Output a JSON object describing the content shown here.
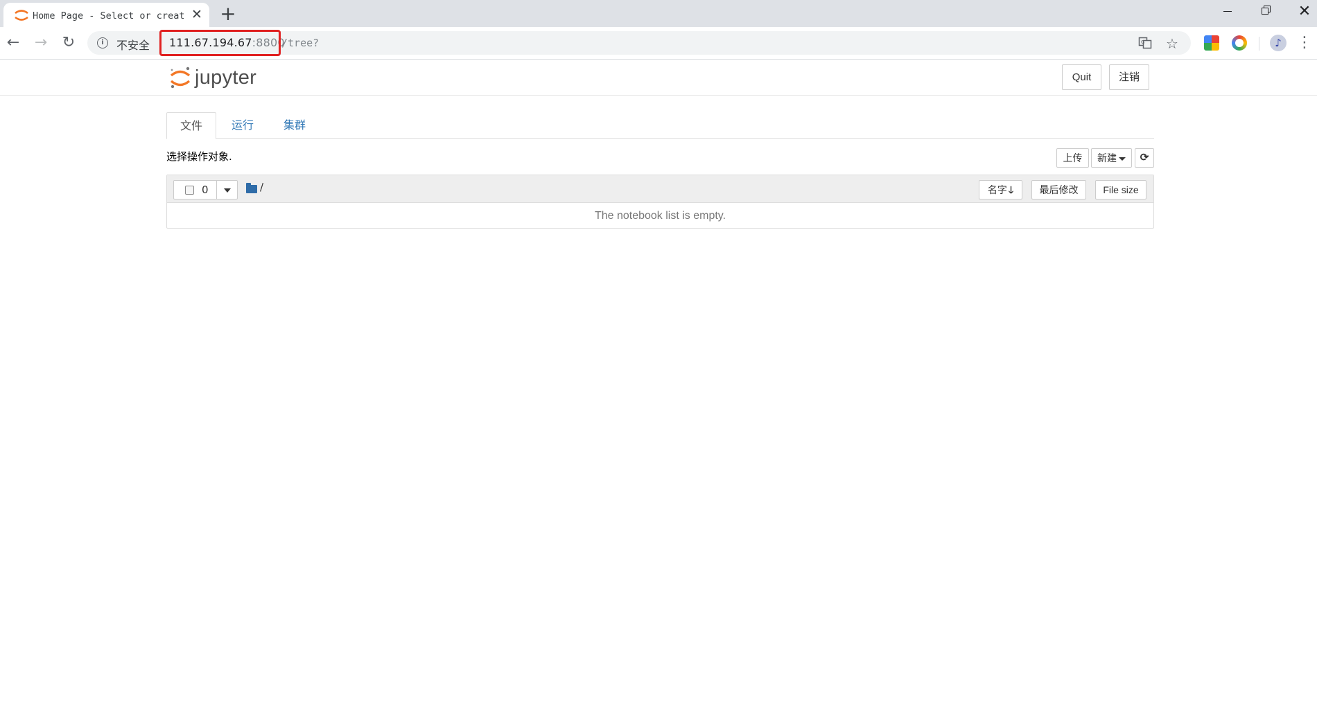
{
  "browser": {
    "tab_title": "Home Page - Select or create",
    "close_glyph": "✕",
    "new_tab_glyph": "+",
    "window_close_glyph": "✕",
    "nav": {
      "back_glyph": "←",
      "forward_glyph": "→",
      "reload_glyph": "↻"
    },
    "security_label": "不安全",
    "url_host": "111.67.194.67",
    "url_port": ":8800",
    "url_path": "/tree?",
    "avatar_glyph": "♪",
    "menu_glyph": "⋮",
    "icons": [
      "info-icon",
      "translate-icon",
      "star-icon",
      "extension-colors-icon",
      "extension-ring-icon",
      "avatar",
      "menu-icon"
    ]
  },
  "header": {
    "logo_text": "jupyter",
    "quit_label": "Quit",
    "logout_label": "注销"
  },
  "tabs": [
    {
      "label": "文件",
      "active": true
    },
    {
      "label": "运行",
      "active": false
    },
    {
      "label": "集群",
      "active": false
    }
  ],
  "toolbar": {
    "select_hint": "选择操作对象.",
    "upload_label": "上传",
    "new_label": "新建",
    "refresh_glyph": "⟳"
  },
  "list": {
    "selected_count": "0",
    "breadcrumb_root": "/",
    "sort_name_label": "名字",
    "sort_arrow": "🡓",
    "sort_modified_label": "最后修改",
    "sort_size_label": "File size",
    "empty_message": "The notebook list is empty."
  },
  "colors": {
    "jupyter_orange": "#f37726",
    "link_blue": "#337ab7",
    "highlight_red": "#e02020"
  }
}
